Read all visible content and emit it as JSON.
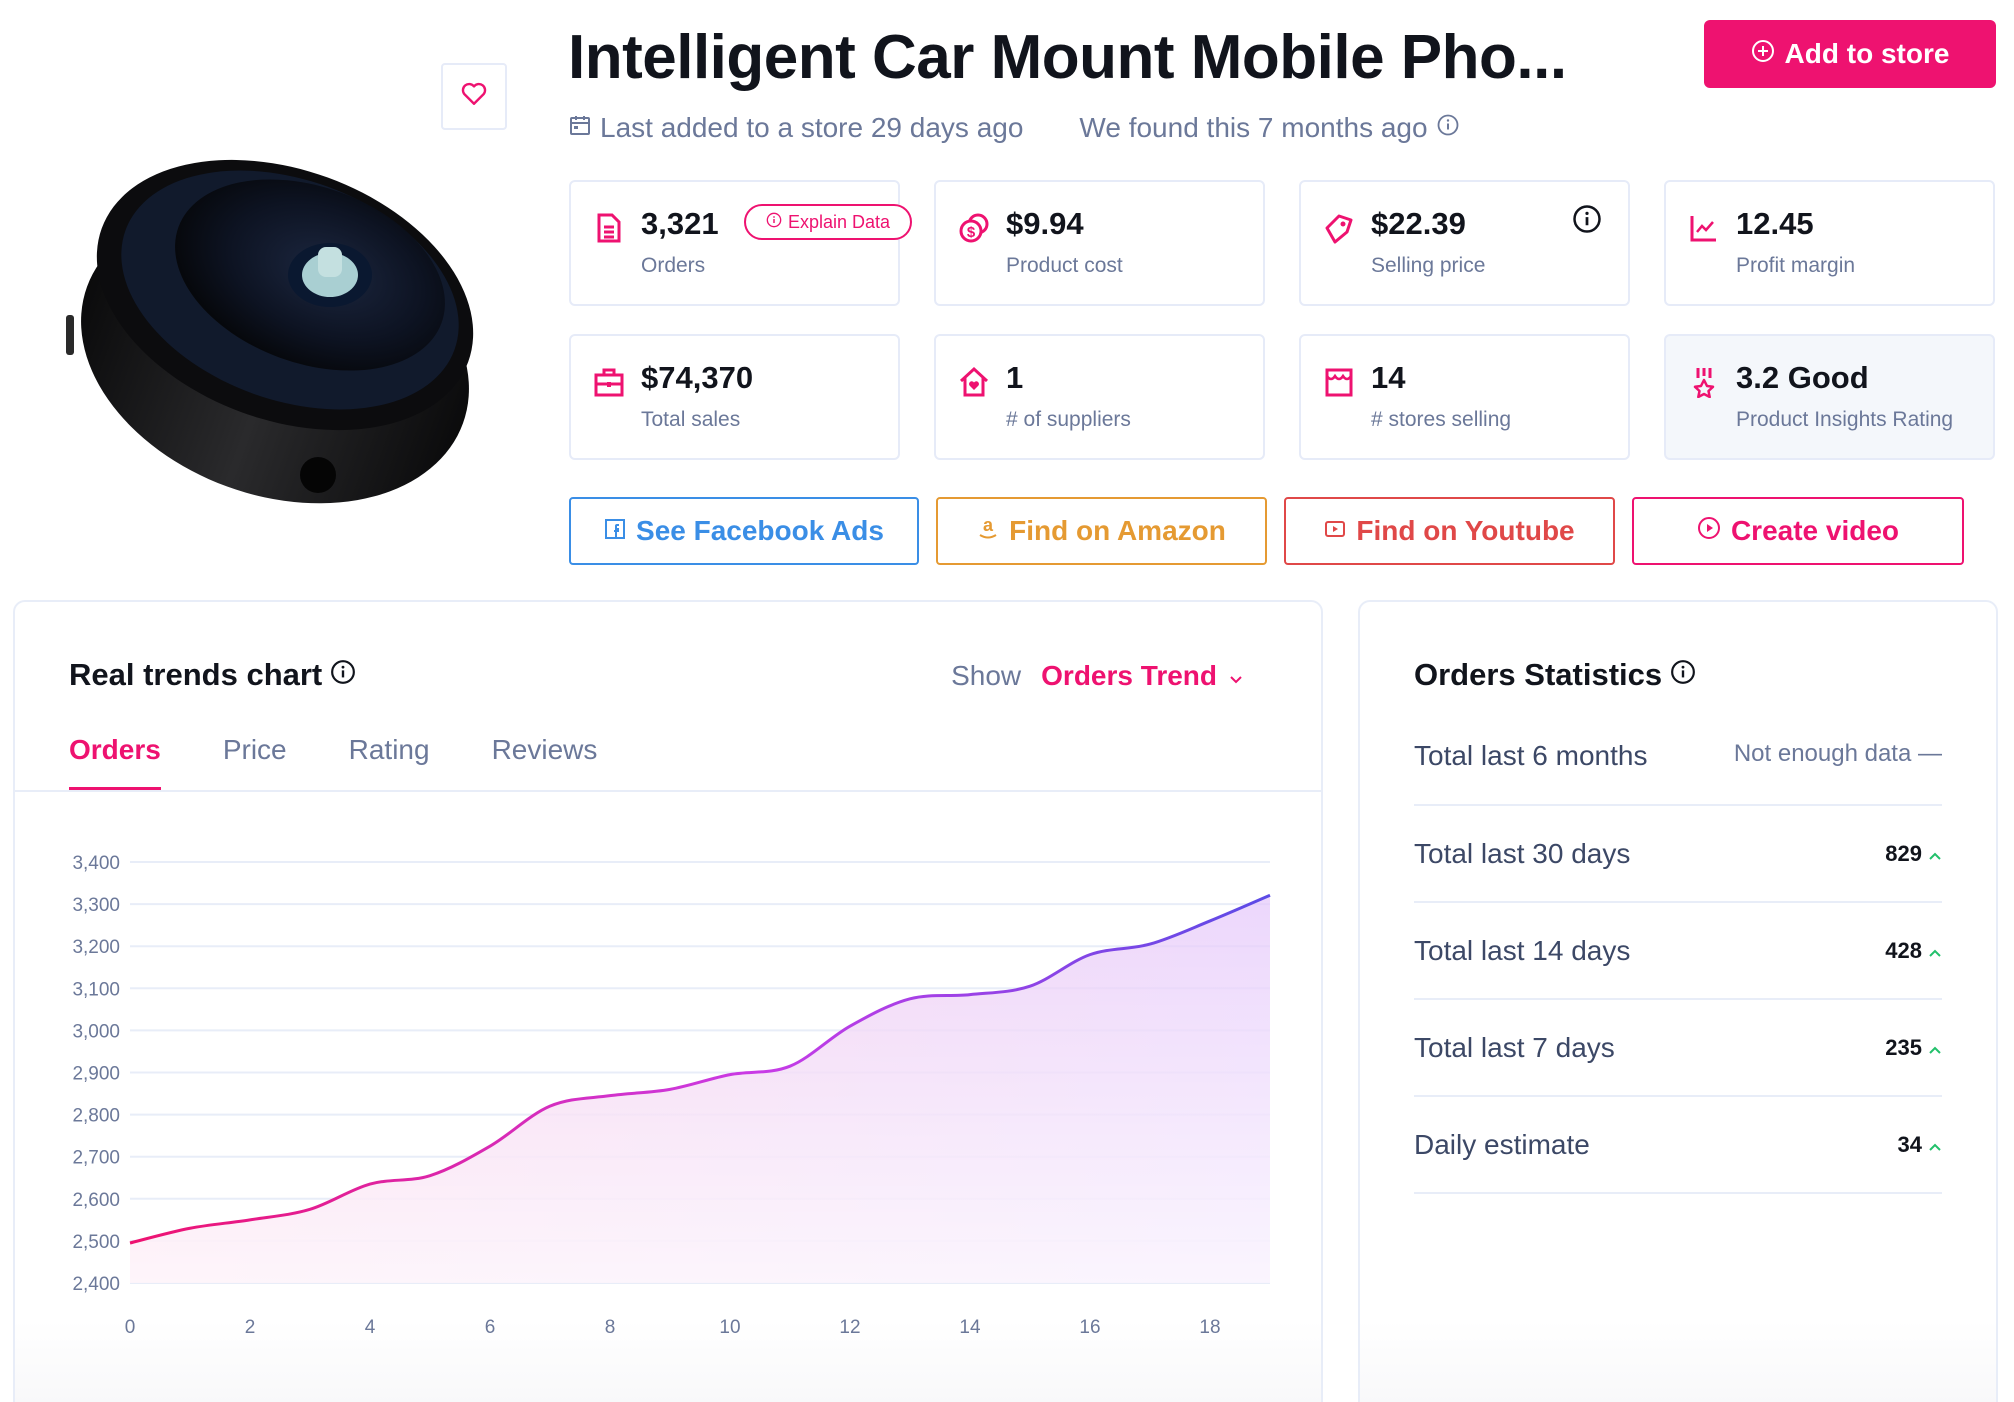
{
  "product": {
    "title": "Intelligent Car Mount Mobile Pho...",
    "image_alt": "Black round car mount product image",
    "favorite_icon": "heart-icon"
  },
  "header": {
    "add_to_store_label": "Add to store",
    "last_added": "Last added to a store 29 days ago",
    "found": "We found this 7 months ago"
  },
  "stats": [
    {
      "icon": "document-icon",
      "value": "3,321",
      "label": "Orders",
      "extra_button": "Explain Data"
    },
    {
      "icon": "coins-icon",
      "value": "$9.94",
      "label": "Product cost"
    },
    {
      "icon": "tag-icon",
      "value": "$22.39",
      "label": "Selling price",
      "info": true
    },
    {
      "icon": "trend-icon",
      "value": "12.45",
      "label": "Profit margin"
    },
    {
      "icon": "briefcase-icon",
      "value": "$74,370",
      "label": "Total sales"
    },
    {
      "icon": "house-heart-icon",
      "value": "1",
      "label": "# of suppliers"
    },
    {
      "icon": "store-icon",
      "value": "14",
      "label": "# stores selling"
    },
    {
      "icon": "award-icon",
      "value": "3.2 Good",
      "label": "Product Insights Rating"
    }
  ],
  "actions": [
    {
      "label": "See Facebook Ads",
      "icon": "facebook-icon",
      "color": "#3a8ee6"
    },
    {
      "label": "Find on Amazon",
      "icon": "amazon-icon",
      "color": "#e59a32"
    },
    {
      "label": "Find on Youtube",
      "icon": "youtube-icon",
      "color": "#e04848"
    },
    {
      "label": "Create video",
      "icon": "play-circle-icon",
      "color": "#ee1270"
    }
  ],
  "trends": {
    "title": "Real trends chart",
    "show_label": "Show",
    "show_value": "Orders Trend",
    "tabs": [
      "Orders",
      "Price",
      "Rating",
      "Reviews"
    ],
    "active_tab": "Orders"
  },
  "orders_statistics": {
    "title": "Orders Statistics",
    "rows": [
      {
        "label": "Total last 6 months",
        "value": "Not enough data —",
        "muted": true
      },
      {
        "label": "Total last 30 days",
        "value": "829",
        "trend": "up"
      },
      {
        "label": "Total last 14 days",
        "value": "428",
        "trend": "up"
      },
      {
        "label": "Total last 7 days",
        "value": "235",
        "trend": "up"
      },
      {
        "label": "Daily estimate",
        "value": "34",
        "trend": "up"
      }
    ]
  },
  "colors": {
    "accent": "#ee1270",
    "muted_text": "#6b7899",
    "trend_up": "#22c06b",
    "line_start": "#ee1270",
    "line_mid": "#c93be6",
    "line_end": "#5b4be6"
  },
  "chart_data": {
    "type": "area",
    "title": "",
    "xlabel": "",
    "ylabel": "",
    "x": [
      0,
      1,
      2,
      3,
      4,
      5,
      6,
      7,
      8,
      9,
      10,
      11,
      12,
      13,
      14,
      15,
      16,
      17,
      18,
      19
    ],
    "values": [
      2495,
      2530,
      2550,
      2575,
      2635,
      2655,
      2725,
      2820,
      2845,
      2860,
      2895,
      2915,
      3010,
      3075,
      3085,
      3105,
      3180,
      3205,
      3260,
      3321
    ],
    "xticks": [
      "0",
      "2",
      "4",
      "6",
      "8",
      "10",
      "12",
      "14",
      "16",
      "18"
    ],
    "yticks": [
      "2,400",
      "2,500",
      "2,600",
      "2,700",
      "2,800",
      "2,900",
      "3,000",
      "3,100",
      "3,200",
      "3,300",
      "3,400"
    ],
    "xlim": [
      0,
      19
    ],
    "ylim": [
      2400,
      3400
    ],
    "grid": true,
    "legend": "none"
  }
}
